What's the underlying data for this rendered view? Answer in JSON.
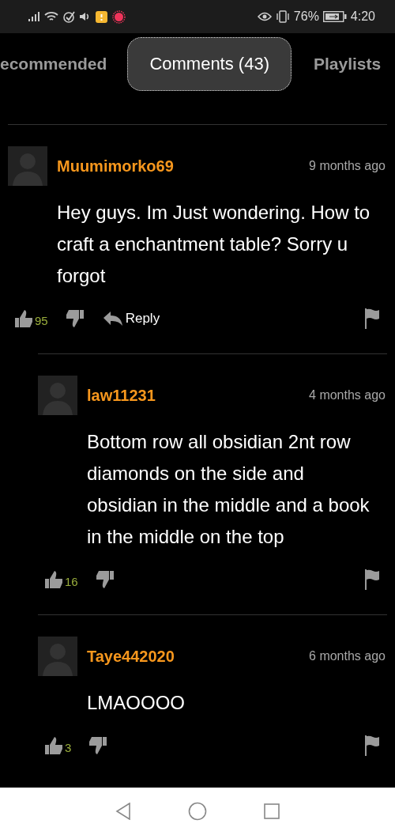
{
  "status_bar": {
    "battery": "76%",
    "time": "4:20"
  },
  "tabs": [
    {
      "label": "ecommended",
      "selected": false
    },
    {
      "label": "Comments (43)",
      "selected": true
    },
    {
      "label": "Playlists",
      "selected": false
    }
  ],
  "comments": [
    {
      "user": "Muumimorko69",
      "time": "9 months ago",
      "text": "Hey guys. Im Just wondering. How to craft a enchantment table? Sorry u forgot",
      "likes": "95",
      "reply_label": "Reply",
      "children": [
        {
          "user": "law11231",
          "time": "4 months ago",
          "text": "Bottom row all obsidian 2nt row diamonds on the side and obsidian in the middle and a book in the middle on the top",
          "likes": "16"
        },
        {
          "user": "Taye442020",
          "time": "6 months ago",
          "text": "LMAOOOO",
          "likes": "3"
        }
      ]
    }
  ]
}
